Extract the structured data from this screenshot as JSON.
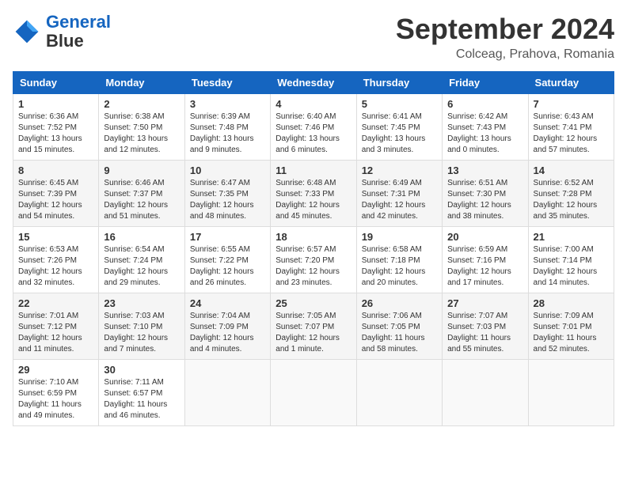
{
  "logo": {
    "line1": "General",
    "line2": "Blue"
  },
  "title": "September 2024",
  "location": "Colceag, Prahova, Romania",
  "weekdays": [
    "Sunday",
    "Monday",
    "Tuesday",
    "Wednesday",
    "Thursday",
    "Friday",
    "Saturday"
  ],
  "weeks": [
    [
      {
        "day": "1",
        "info": "Sunrise: 6:36 AM\nSunset: 7:52 PM\nDaylight: 13 hours\nand 15 minutes."
      },
      {
        "day": "2",
        "info": "Sunrise: 6:38 AM\nSunset: 7:50 PM\nDaylight: 13 hours\nand 12 minutes."
      },
      {
        "day": "3",
        "info": "Sunrise: 6:39 AM\nSunset: 7:48 PM\nDaylight: 13 hours\nand 9 minutes."
      },
      {
        "day": "4",
        "info": "Sunrise: 6:40 AM\nSunset: 7:46 PM\nDaylight: 13 hours\nand 6 minutes."
      },
      {
        "day": "5",
        "info": "Sunrise: 6:41 AM\nSunset: 7:45 PM\nDaylight: 13 hours\nand 3 minutes."
      },
      {
        "day": "6",
        "info": "Sunrise: 6:42 AM\nSunset: 7:43 PM\nDaylight: 13 hours\nand 0 minutes."
      },
      {
        "day": "7",
        "info": "Sunrise: 6:43 AM\nSunset: 7:41 PM\nDaylight: 12 hours\nand 57 minutes."
      }
    ],
    [
      {
        "day": "8",
        "info": "Sunrise: 6:45 AM\nSunset: 7:39 PM\nDaylight: 12 hours\nand 54 minutes."
      },
      {
        "day": "9",
        "info": "Sunrise: 6:46 AM\nSunset: 7:37 PM\nDaylight: 12 hours\nand 51 minutes."
      },
      {
        "day": "10",
        "info": "Sunrise: 6:47 AM\nSunset: 7:35 PM\nDaylight: 12 hours\nand 48 minutes."
      },
      {
        "day": "11",
        "info": "Sunrise: 6:48 AM\nSunset: 7:33 PM\nDaylight: 12 hours\nand 45 minutes."
      },
      {
        "day": "12",
        "info": "Sunrise: 6:49 AM\nSunset: 7:31 PM\nDaylight: 12 hours\nand 42 minutes."
      },
      {
        "day": "13",
        "info": "Sunrise: 6:51 AM\nSunset: 7:30 PM\nDaylight: 12 hours\nand 38 minutes."
      },
      {
        "day": "14",
        "info": "Sunrise: 6:52 AM\nSunset: 7:28 PM\nDaylight: 12 hours\nand 35 minutes."
      }
    ],
    [
      {
        "day": "15",
        "info": "Sunrise: 6:53 AM\nSunset: 7:26 PM\nDaylight: 12 hours\nand 32 minutes."
      },
      {
        "day": "16",
        "info": "Sunrise: 6:54 AM\nSunset: 7:24 PM\nDaylight: 12 hours\nand 29 minutes."
      },
      {
        "day": "17",
        "info": "Sunrise: 6:55 AM\nSunset: 7:22 PM\nDaylight: 12 hours\nand 26 minutes."
      },
      {
        "day": "18",
        "info": "Sunrise: 6:57 AM\nSunset: 7:20 PM\nDaylight: 12 hours\nand 23 minutes."
      },
      {
        "day": "19",
        "info": "Sunrise: 6:58 AM\nSunset: 7:18 PM\nDaylight: 12 hours\nand 20 minutes."
      },
      {
        "day": "20",
        "info": "Sunrise: 6:59 AM\nSunset: 7:16 PM\nDaylight: 12 hours\nand 17 minutes."
      },
      {
        "day": "21",
        "info": "Sunrise: 7:00 AM\nSunset: 7:14 PM\nDaylight: 12 hours\nand 14 minutes."
      }
    ],
    [
      {
        "day": "22",
        "info": "Sunrise: 7:01 AM\nSunset: 7:12 PM\nDaylight: 12 hours\nand 11 minutes."
      },
      {
        "day": "23",
        "info": "Sunrise: 7:03 AM\nSunset: 7:10 PM\nDaylight: 12 hours\nand 7 minutes."
      },
      {
        "day": "24",
        "info": "Sunrise: 7:04 AM\nSunset: 7:09 PM\nDaylight: 12 hours\nand 4 minutes."
      },
      {
        "day": "25",
        "info": "Sunrise: 7:05 AM\nSunset: 7:07 PM\nDaylight: 12 hours\nand 1 minute."
      },
      {
        "day": "26",
        "info": "Sunrise: 7:06 AM\nSunset: 7:05 PM\nDaylight: 11 hours\nand 58 minutes."
      },
      {
        "day": "27",
        "info": "Sunrise: 7:07 AM\nSunset: 7:03 PM\nDaylight: 11 hours\nand 55 minutes."
      },
      {
        "day": "28",
        "info": "Sunrise: 7:09 AM\nSunset: 7:01 PM\nDaylight: 11 hours\nand 52 minutes."
      }
    ],
    [
      {
        "day": "29",
        "info": "Sunrise: 7:10 AM\nSunset: 6:59 PM\nDaylight: 11 hours\nand 49 minutes."
      },
      {
        "day": "30",
        "info": "Sunrise: 7:11 AM\nSunset: 6:57 PM\nDaylight: 11 hours\nand 46 minutes."
      },
      null,
      null,
      null,
      null,
      null
    ]
  ]
}
